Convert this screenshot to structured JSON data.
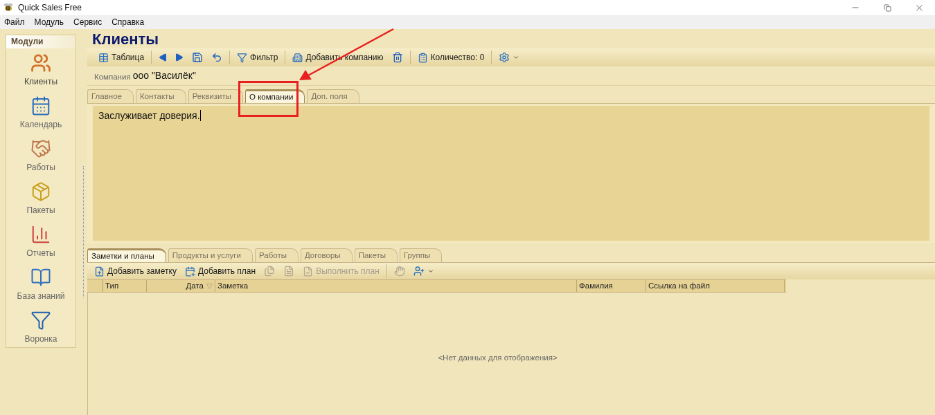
{
  "window": {
    "title": "Quick Sales Free"
  },
  "menu": [
    "Файл",
    "Модуль",
    "Сервис",
    "Справка"
  ],
  "sidebar": {
    "title": "Модули",
    "items": [
      {
        "label": "Клиенты",
        "selected": true
      },
      {
        "label": "Календарь",
        "selected": false
      },
      {
        "label": "Работы",
        "selected": false
      },
      {
        "label": "Пакеты",
        "selected": false
      },
      {
        "label": "Отчеты",
        "selected": false
      },
      {
        "label": "База знаний",
        "selected": false
      },
      {
        "label": "Воронка",
        "selected": false
      }
    ]
  },
  "page_title": "Клиенты",
  "toolbar": [
    {
      "kind": "button",
      "label": "Таблица"
    },
    {
      "kind": "separator"
    },
    {
      "kind": "icon"
    },
    {
      "kind": "icon"
    },
    {
      "kind": "icon"
    },
    {
      "kind": "icon"
    },
    {
      "kind": "separator"
    },
    {
      "kind": "button",
      "label": "Фильтр"
    },
    {
      "kind": "separator"
    },
    {
      "kind": "button",
      "label": "Добавить компанию"
    },
    {
      "kind": "icon"
    },
    {
      "kind": "separator"
    },
    {
      "kind": "button",
      "label": "Количество: 0"
    },
    {
      "kind": "separator"
    },
    {
      "kind": "dropdown"
    }
  ],
  "company": {
    "label": "Компания",
    "value": "ооо \"Василёк\""
  },
  "tabs": [
    {
      "label": "Главное",
      "selected": false
    },
    {
      "label": "Контакты",
      "selected": false
    },
    {
      "label": "Реквизиты",
      "selected": false
    },
    {
      "label": "О компании",
      "selected": true
    },
    {
      "label": "Доп. поля",
      "selected": false
    }
  ],
  "about_text": "Заслуживает доверия.",
  "bottom_tabs": [
    {
      "label": "Заметки и планы",
      "selected": true
    },
    {
      "label": "Продукты и услуги",
      "selected": false
    },
    {
      "label": "Работы",
      "selected": false
    },
    {
      "label": "Договоры",
      "selected": false
    },
    {
      "label": "Пакеты",
      "selected": false
    },
    {
      "label": "Группы",
      "selected": false
    }
  ],
  "notes_toolbar": [
    {
      "kind": "button",
      "label": "Добавить заметку",
      "disabled": false
    },
    {
      "kind": "button",
      "label": "Добавить план",
      "disabled": false
    },
    {
      "kind": "icon",
      "disabled": true
    },
    {
      "kind": "icon",
      "disabled": true
    },
    {
      "kind": "button",
      "label": "Выполнить план",
      "disabled": true
    },
    {
      "kind": "separator"
    },
    {
      "kind": "icon",
      "disabled": true
    },
    {
      "kind": "dropdown",
      "disabled": false
    }
  ],
  "table": {
    "columns": [
      {
        "label": "Тип",
        "sorted": false
      },
      {
        "label": "Дата",
        "sorted": true
      },
      {
        "label": "Заметка",
        "sorted": false
      },
      {
        "label": "Фамилия",
        "sorted": false
      },
      {
        "label": "Ссылка на файл",
        "sorted": false
      }
    ],
    "empty_message": "<Нет данных для отображения>"
  }
}
